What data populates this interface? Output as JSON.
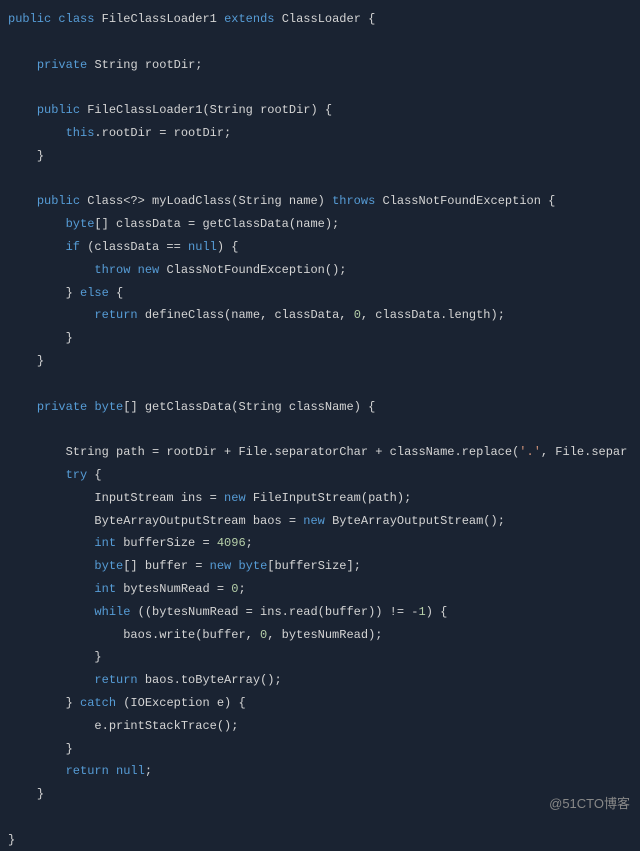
{
  "code": {
    "l1": {
      "kw1": "public",
      "kw2": "class",
      "name": "FileClassLoader1",
      "kw3": "extends",
      "parent": "ClassLoader",
      "brace": "{"
    },
    "l2": {
      "kw1": "private",
      "type": "String",
      "name": "rootDir;"
    },
    "l3": {
      "kw1": "public",
      "name": "FileClassLoader1(String rootDir) {"
    },
    "l4": {
      "kw1": "this",
      "rest": ".rootDir = rootDir;"
    },
    "l5": "}",
    "l6": {
      "kw1": "public",
      "type": "Class<?>",
      "name": "myLoadClass(String name)",
      "kw2": "throws",
      "ex": "ClassNotFoundException {"
    },
    "l7": {
      "kw1": "byte",
      "rest": "[] classData = getClassData(name);"
    },
    "l8": {
      "kw1": "if",
      "rest": "(classData ==",
      "kw2": "null",
      "rest2": ") {"
    },
    "l9": {
      "kw1": "throw",
      "kw2": "new",
      "rest": "ClassNotFoundException();"
    },
    "l10": {
      "rest": "}",
      "kw1": "else",
      "rest2": "{"
    },
    "l11": {
      "kw1": "return",
      "rest": "defineClass(name, classData,",
      "num1": "0",
      "rest2": ", classData.length);"
    },
    "l12": "}",
    "l13": "}",
    "l14": {
      "kw1": "private",
      "kw2": "byte",
      "rest": "[] getClassData(String className) {"
    },
    "l15": {
      "pre": "String path = rootDir + File.separatorChar + className.replace(",
      "str1": "'.'",
      "mid": ", File.separ"
    },
    "l16": {
      "kw1": "try",
      "rest": "{"
    },
    "l17": {
      "pre": "InputStream ins =",
      "kw1": "new",
      "rest": "FileInputStream(path);"
    },
    "l18": {
      "pre": "ByteArrayOutputStream baos =",
      "kw1": "new",
      "rest": "ByteArrayOutputStream();"
    },
    "l19": {
      "kw1": "int",
      "name": "bufferSize =",
      "num": "4096",
      "semi": ";"
    },
    "l20": {
      "kw1": "byte",
      "rest": "[] buffer =",
      "kw2": "new",
      "kw3": "byte",
      "rest2": "[bufferSize];"
    },
    "l21": {
      "kw1": "int",
      "name": "bytesNumRead =",
      "num": "0",
      "semi": ";"
    },
    "l22": {
      "kw1": "while",
      "rest": "((bytesNumRead = ins.read(buffer)) != -",
      "num": "1",
      "rest2": ") {"
    },
    "l23": {
      "pre": "baos.write(buffer,",
      "num1": "0",
      "rest": ", bytesNumRead);"
    },
    "l24": "}",
    "l25": {
      "kw1": "return",
      "rest": "baos.toByteArray();"
    },
    "l26": {
      "rest": "}",
      "kw1": "catch",
      "rest2": "(IOException e) {"
    },
    "l27": "e.printStackTrace();",
    "l28": "}",
    "l29": {
      "kw1": "return",
      "kw2": "null",
      "semi": ";"
    },
    "l30": "}",
    "l31": "}"
  },
  "watermark": "@51CTO博客"
}
